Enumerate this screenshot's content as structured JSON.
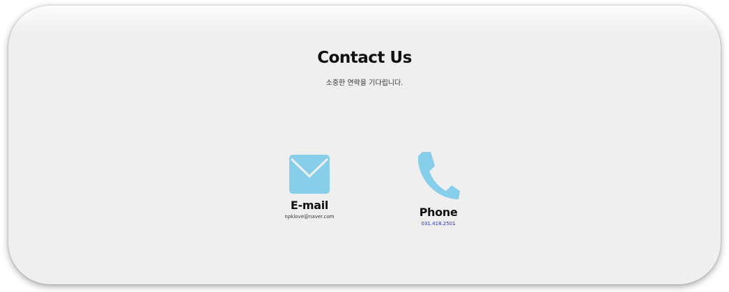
{
  "section": {
    "title": "Contact Us",
    "subtitle": "소중한 연락을 기다립니다."
  },
  "contacts": [
    {
      "icon": "envelope-icon",
      "label": "E-mail",
      "value": "npklove@naver.com"
    },
    {
      "icon": "phone-icon",
      "label": "Phone",
      "value": "031.418.2501"
    }
  ],
  "colors": {
    "icon": "#87ceeb",
    "background": "#efefef",
    "phone_link": "#2b2bd6"
  }
}
